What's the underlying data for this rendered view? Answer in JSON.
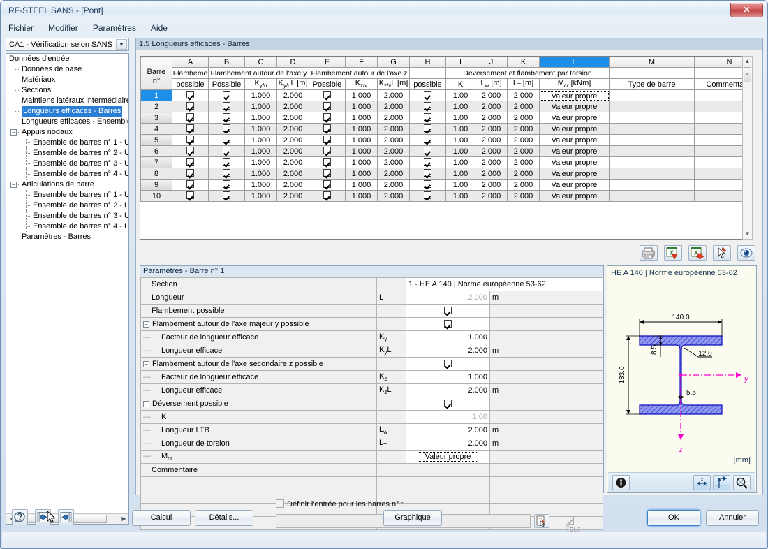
{
  "window": {
    "title": "RF-STEEL SANS - [Pont]",
    "close_label": "✕"
  },
  "menubar": {
    "items": [
      "Fichier",
      "Modifier",
      "Paramètres",
      "Aide"
    ]
  },
  "sidebar": {
    "combo_value": "CA1 - Vérification selon SANS",
    "tree": [
      {
        "label": "Données d'entrée",
        "level": 0,
        "type": "root"
      },
      {
        "label": "Données de base",
        "level": 1,
        "type": "leaf"
      },
      {
        "label": "Matériaux",
        "level": 1,
        "type": "leaf"
      },
      {
        "label": "Sections",
        "level": 1,
        "type": "leaf"
      },
      {
        "label": "Maintiens latéraux intermédiaires",
        "level": 1,
        "type": "leaf"
      },
      {
        "label": "Longueurs efficaces - Barres",
        "level": 1,
        "type": "leaf",
        "selected": true
      },
      {
        "label": "Longueurs efficaces - Ensembles",
        "level": 1,
        "type": "leaf"
      },
      {
        "label": "Appuis nodaux",
        "level": 1,
        "type": "group",
        "expander": "−"
      },
      {
        "label": "Ensemble de barres n° 1 - U",
        "level": 2,
        "type": "leaf"
      },
      {
        "label": "Ensemble de barres n° 2 - U",
        "level": 2,
        "type": "leaf"
      },
      {
        "label": "Ensemble de barres n° 3 - U",
        "level": 2,
        "type": "leaf"
      },
      {
        "label": "Ensemble de barres n° 4 - U",
        "level": 2,
        "type": "leaf"
      },
      {
        "label": "Articulations de barre",
        "level": 1,
        "type": "group",
        "expander": "−"
      },
      {
        "label": "Ensemble de barres n° 1 - U",
        "level": 2,
        "type": "leaf"
      },
      {
        "label": "Ensemble de barres n° 2 - U",
        "level": 2,
        "type": "leaf"
      },
      {
        "label": "Ensemble de barres n° 3 - U",
        "level": 2,
        "type": "leaf"
      },
      {
        "label": "Ensemble de barres n° 4 - U",
        "level": 2,
        "type": "leaf"
      },
      {
        "label": "Paramètres - Barres",
        "level": 1,
        "type": "leaf"
      }
    ]
  },
  "main": {
    "panel_title": "1.5 Longueurs efficaces - Barres"
  },
  "grid": {
    "column_letters": [
      "",
      "A",
      "B",
      "C",
      "D",
      "E",
      "F",
      "G",
      "H",
      "I",
      "J",
      "K",
      "L",
      "M",
      "N"
    ],
    "selected_column_letter": "L",
    "row_header_title_line1": "Barre",
    "row_header_title_line2": "n°",
    "group_headers": [
      {
        "label": "Flambeme",
        "span": 1
      },
      {
        "label": "Flambement autour de l'axe y",
        "span": 3
      },
      {
        "label": "Flambement autour de l'axe z",
        "span": 3
      },
      {
        "label": "",
        "span": 1
      },
      {
        "label": "Déversement et flambement par torsion",
        "span": 4
      },
      {
        "label": "",
        "span": 1
      },
      {
        "label": "",
        "span": 1
      }
    ],
    "sub_headers": [
      "possible",
      "Possible",
      "K<sub>y/u</sub>",
      "K<sub>y/u</sub>L [m]",
      "Possible",
      "K<sub>z/v</sub>",
      "K<sub>z/v</sub>L [m]",
      "possible",
      "K",
      "L<sub>w</sub> [m]",
      "L<sub>T</sub> [m]",
      "M<sub>cr</sub> [kNm]",
      "Type de barre",
      "Commentaire"
    ],
    "rows": [
      {
        "n": "1",
        "A": "check",
        "B": "check",
        "C": "1.000",
        "D": "2.000",
        "E": "check",
        "F": "1.000",
        "G": "2.000",
        "H": "check",
        "I": "1.00",
        "J": "2.000",
        "K": "2.000",
        "L": "Valeur propre",
        "M": "",
        "N": ""
      },
      {
        "n": "2",
        "A": "check",
        "B": "check",
        "C": "1.000",
        "D": "2.000",
        "E": "check",
        "F": "1.000",
        "G": "2.000",
        "H": "check",
        "I": "1.00",
        "J": "2.000",
        "K": "2.000",
        "L": "Valeur propre",
        "M": "",
        "N": ""
      },
      {
        "n": "3",
        "A": "check",
        "B": "check",
        "C": "1.000",
        "D": "2.000",
        "E": "check",
        "F": "1.000",
        "G": "2.000",
        "H": "check",
        "I": "1.00",
        "J": "2.000",
        "K": "2.000",
        "L": "Valeur propre",
        "M": "",
        "N": ""
      },
      {
        "n": "4",
        "A": "check",
        "B": "check",
        "C": "1.000",
        "D": "2.000",
        "E": "check",
        "F": "1.000",
        "G": "2.000",
        "H": "check",
        "I": "1.00",
        "J": "2.000",
        "K": "2.000",
        "L": "Valeur propre",
        "M": "",
        "N": ""
      },
      {
        "n": "5",
        "A": "check",
        "B": "check",
        "C": "1.000",
        "D": "2.000",
        "E": "check",
        "F": "1.000",
        "G": "2.000",
        "H": "check",
        "I": "1.00",
        "J": "2.000",
        "K": "2.000",
        "L": "Valeur propre",
        "M": "",
        "N": ""
      },
      {
        "n": "6",
        "A": "check",
        "B": "check",
        "C": "1.000",
        "D": "2.000",
        "E": "check",
        "F": "1.000",
        "G": "2.000",
        "H": "check",
        "I": "1.00",
        "J": "2.000",
        "K": "2.000",
        "L": "Valeur propre",
        "M": "",
        "N": ""
      },
      {
        "n": "7",
        "A": "check",
        "B": "check",
        "C": "1.000",
        "D": "2.000",
        "E": "check",
        "F": "1.000",
        "G": "2.000",
        "H": "check",
        "I": "1.00",
        "J": "2.000",
        "K": "2.000",
        "L": "Valeur propre",
        "M": "",
        "N": ""
      },
      {
        "n": "8",
        "A": "check",
        "B": "check",
        "C": "1.000",
        "D": "2.000",
        "E": "check",
        "F": "1.000",
        "G": "2.000",
        "H": "check",
        "I": "1.00",
        "J": "2.000",
        "K": "2.000",
        "L": "Valeur propre",
        "M": "",
        "N": ""
      },
      {
        "n": "9",
        "A": "check",
        "B": "check",
        "C": "1.000",
        "D": "2.000",
        "E": "check",
        "F": "1.000",
        "G": "2.000",
        "H": "check",
        "I": "1.00",
        "J": "2.000",
        "K": "2.000",
        "L": "Valeur propre",
        "M": "",
        "N": ""
      },
      {
        "n": "10",
        "A": "check",
        "B": "check",
        "C": "1.000",
        "D": "2.000",
        "E": "check",
        "F": "1.000",
        "G": "2.000",
        "H": "check",
        "I": "1.00",
        "J": "2.000",
        "K": "2.000",
        "L": "Valeur propre",
        "M": "",
        "N": ""
      }
    ],
    "selected_row": "1"
  },
  "params": {
    "title": "Paramètres - Barre n° 1",
    "rows": [
      {
        "name": "Section",
        "symbol": "",
        "value": "1 - HE A 140 | Norme européenne 53-62",
        "unit": "",
        "kind": "fulltext",
        "indent": 1
      },
      {
        "name": "Longueur",
        "symbol": "L",
        "value": "2.000",
        "unit": "m",
        "kind": "value-grey",
        "indent": 1
      },
      {
        "name": "Flambement possible",
        "symbol": "",
        "value": "check",
        "unit": "",
        "kind": "check",
        "indent": 1
      },
      {
        "name": "Flambement autour de l'axe majeur y possible",
        "symbol": "",
        "value": "check",
        "unit": "",
        "kind": "check",
        "indent": 0,
        "expander": "−"
      },
      {
        "name": "Facteur de longueur efficace",
        "symbol": "Ky",
        "value": "1.000",
        "unit": "",
        "kind": "value",
        "indent": 2,
        "dash": true
      },
      {
        "name": "Longueur efficace",
        "symbol": "KyL",
        "value": "2.000",
        "unit": "m",
        "kind": "value",
        "indent": 2,
        "dash": true
      },
      {
        "name": "Flambement autour de l'axe secondaire z possible",
        "symbol": "",
        "value": "check",
        "unit": "",
        "kind": "check",
        "indent": 0,
        "expander": "−"
      },
      {
        "name": "Facteur de longueur efficace",
        "symbol": "Kz",
        "value": "1.000",
        "unit": "",
        "kind": "value",
        "indent": 2,
        "dash": true
      },
      {
        "name": "Longueur efficace",
        "symbol": "KzL",
        "value": "2.000",
        "unit": "m",
        "kind": "value",
        "indent": 2,
        "dash": true
      },
      {
        "name": "Déversement possible",
        "symbol": "",
        "value": "check",
        "unit": "",
        "kind": "check",
        "indent": 0,
        "expander": "−"
      },
      {
        "name": "K",
        "symbol": "",
        "value": "1.00",
        "unit": "",
        "kind": "value-grey",
        "indent": 2,
        "dash": true
      },
      {
        "name": "Longueur LTB",
        "symbol": "Lw",
        "value": "2.000",
        "unit": "m",
        "kind": "value",
        "indent": 2,
        "dash": true
      },
      {
        "name": "Longueur de torsion",
        "symbol": "LT",
        "value": "2.000",
        "unit": "m",
        "kind": "value",
        "indent": 2,
        "dash": true
      },
      {
        "name": "Mcr",
        "symbol": "",
        "value": "Valeur propre",
        "unit": "",
        "kind": "boxed",
        "indent": 2,
        "dash": true
      },
      {
        "name": "Commentaire",
        "symbol": "",
        "value": "",
        "unit": "",
        "kind": "blank",
        "indent": 1
      },
      {
        "name": "",
        "symbol": "",
        "value": "",
        "unit": "",
        "kind": "empty",
        "indent": 0
      },
      {
        "name": "",
        "symbol": "",
        "value": "",
        "unit": "",
        "kind": "empty",
        "indent": 0
      },
      {
        "name": "",
        "symbol": "",
        "value": "",
        "unit": "",
        "kind": "empty",
        "indent": 0
      },
      {
        "name": "",
        "symbol": "",
        "value": "",
        "unit": "",
        "kind": "empty",
        "indent": 0
      }
    ]
  },
  "define_entry": {
    "checkbox_label": "Définir l'entrée pour les barres n° :",
    "input_value": "",
    "all_label": "Tout"
  },
  "viewer": {
    "title": "HE A 140 | Norme européenne 53-62",
    "unit": "[mm]",
    "dimensions": {
      "width": "140.0",
      "height": "133.0",
      "flange_thickness": "8.5",
      "web_thickness": "5.5",
      "root_radius": "12.0"
    },
    "axes": {
      "y": "y",
      "z": "z"
    },
    "colors": {
      "section_fill": "#6f7ae0",
      "axis": "#ff00cc"
    }
  },
  "buttons": {
    "calcul": "Calcul",
    "details": "Détails...",
    "graphique": "Graphique",
    "ok": "OK",
    "annuler": "Annuler"
  },
  "icons": {
    "help": "help-icon",
    "prev": "previous-icon",
    "next": "next-icon",
    "print": "print-icon",
    "export_excel": "export-excel-icon",
    "import_excel": "import-excel-icon",
    "pick": "pick-icon",
    "view": "view-icon",
    "info": "info-icon",
    "dim_x": "dimension-x-icon",
    "dim_y": "dimension-y-icon",
    "zoom": "zoom-icon"
  }
}
